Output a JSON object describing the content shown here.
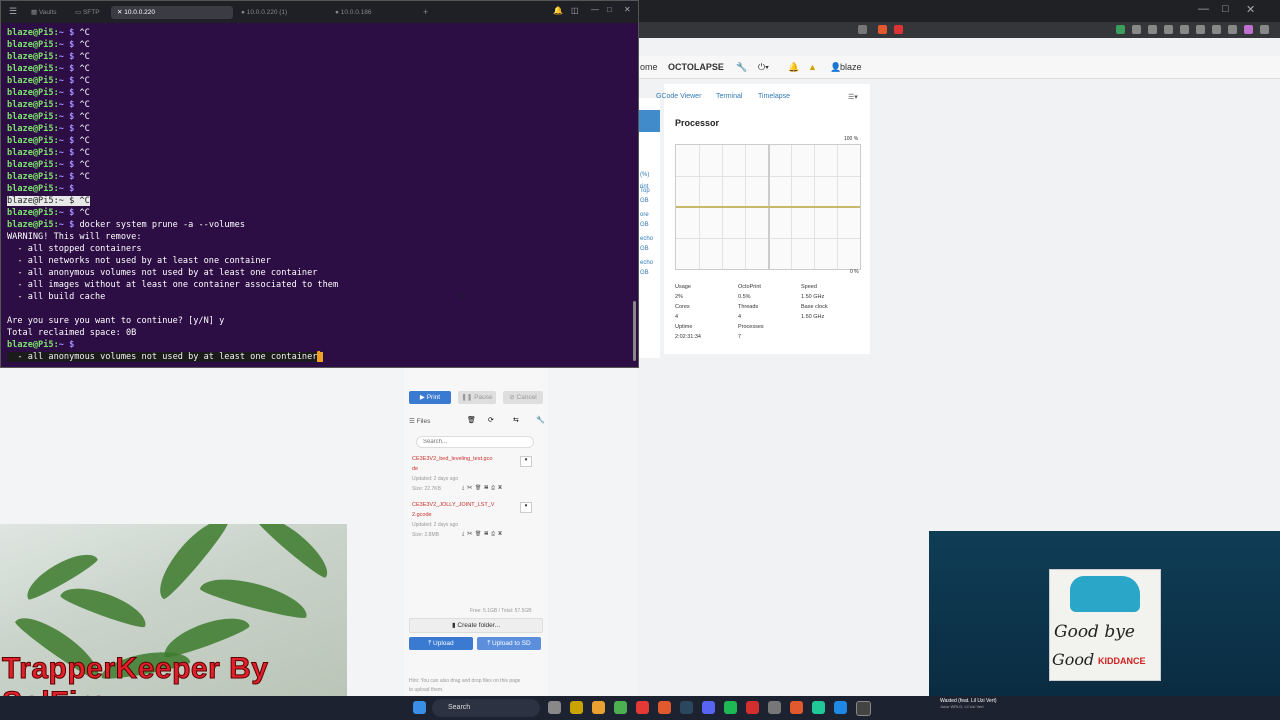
{
  "terminal": {
    "tabs": [
      {
        "label": "Vaults",
        "active": false
      },
      {
        "label": "SFTP",
        "active": false
      },
      {
        "label": "10.0.0.220",
        "active": true
      },
      {
        "label": "10.0.0.220 (1)",
        "active": false
      },
      {
        "label": "10.0.0.186",
        "active": false
      }
    ],
    "new_tab": "+",
    "prompt_user": "blaze@Pi5:",
    "prompt_sym": "~ $",
    "interrupt": "^C",
    "selected_prompt": "blaze@Pi5:~ $ ^C",
    "command": "docker system prune -a --volumes",
    "warning_lines": [
      "WARNING! This will remove:",
      "  - all stopped containers",
      "  - all networks not used by at least one container",
      "  - all anonymous volumes not used by at least one container",
      "  - all images without at least one container associated to them",
      "  - all build cache"
    ],
    "confirm_line": "Are you sure you want to continue? [y/N] y",
    "reclaimed_line": "Total reclaimed space: 0B",
    "highlighted_line": "  - all anonymous volumes not used by at least one container"
  },
  "browser": {
    "nav": {
      "home": "ome",
      "octolapse": "OCTOLAPSE",
      "user": "blaze"
    },
    "tabs": [
      "GCode Viewer",
      "Terminal",
      "Timelapse"
    ],
    "side_labels": [
      "(%)",
      "rint",
      "Top",
      "GB",
      "ore",
      "GB",
      "echo",
      "GB",
      "echo",
      "GB"
    ],
    "processor": {
      "title": "Processor",
      "max_label": "100 %",
      "min_label": "0 %",
      "stats": [
        {
          "label": "Usage",
          "value": "2%"
        },
        {
          "label": "OctoPrint",
          "value": "0.5%"
        },
        {
          "label": "Speed",
          "value": "1.50 GHz"
        },
        {
          "label": "Cores",
          "value": "4"
        },
        {
          "label": "Threads",
          "value": "4"
        },
        {
          "label": "Base clock",
          "value": "1.50 GHz"
        },
        {
          "label": "Uptime",
          "value": "2:02:31:34"
        },
        {
          "label": "Processes",
          "value": "7"
        }
      ]
    },
    "files": {
      "print": "Print",
      "pause": "Pause",
      "cancel": "Cancel",
      "header": "Files",
      "search_placeholder": "Search...",
      "items": [
        {
          "name": "CE3E3V2_bed_leveling_test.gcode",
          "name_l1": "CE3E3V2_bed_leveling_test.gco",
          "name_l2": "de",
          "updated": "Updated: 2 days ago",
          "size": "Size: 22.7KB"
        },
        {
          "name": "CE3E3V2_JOLLY_JOINT_LST_V2.gcode",
          "name_l1": "CE3E3V2_JOLLY_JOINT_LST_V",
          "name_l2": "2.gcode",
          "updated": "Updated: 2 days ago",
          "size": "Size: 2.8MB"
        }
      ],
      "free_total": "Free: 5.1GB / Total: 57.5GB",
      "create_folder": "Create folder...",
      "upload": "Upload",
      "upload_sd": "Upload to SD",
      "hint": "Hint: You can also drag and drop files on this page",
      "hint2": "to upload them."
    }
  },
  "webcam": {
    "overlay_text": "TrapperKeeper By SolFire"
  },
  "media": {
    "album_title_1": "Good bye",
    "album_title_2": "Good",
    "album_title_3": "KIDDANCE",
    "now_playing": "Wasted (feat. Lil Uzi Vert)",
    "artist": "Juice WRLD, Lil Uzi Vert"
  },
  "taskbar": {
    "search": "Search"
  }
}
